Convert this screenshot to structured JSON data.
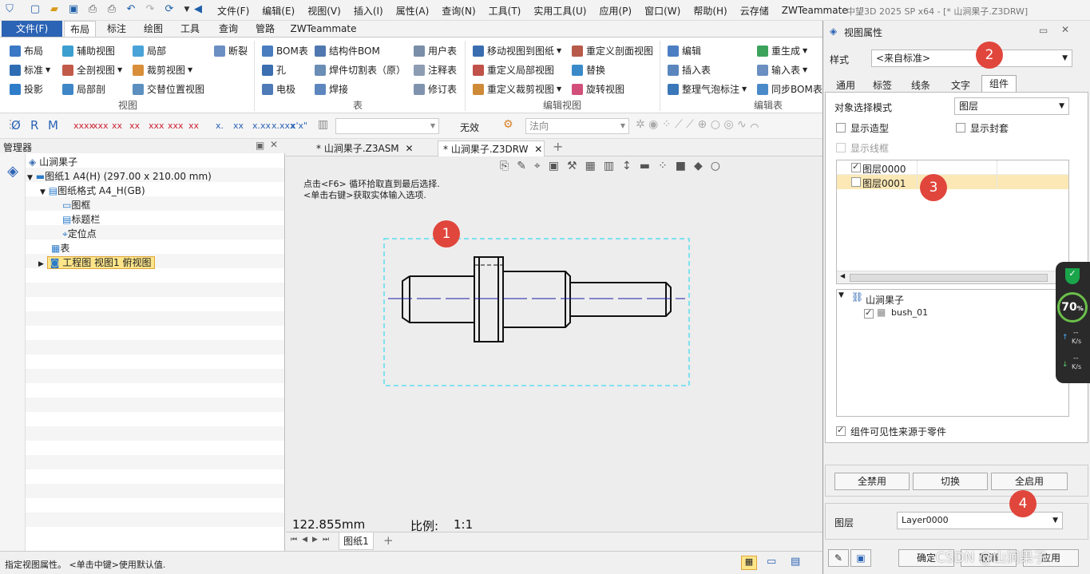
{
  "titlebar": {
    "menus": [
      "文件(F)",
      "编辑(E)",
      "视图(V)",
      "插入(I)",
      "属性(A)",
      "查询(N)",
      "工具(T)",
      "实用工具(U)",
      "应用(P)",
      "窗口(W)",
      "帮助(H)",
      "云存储",
      "ZWTeammate"
    ],
    "window_title": "中望3D 2025 SP x64 - [* 山涧果子.Z3DRW]"
  },
  "ribbon": {
    "file_tab": "文件(F)",
    "tabs": [
      "布局",
      "标注",
      "绘图",
      "工具",
      "查询",
      "管路",
      "ZWTeammate"
    ],
    "active_tab": "布局",
    "view_group": {
      "label": "视图",
      "items": [
        "布局",
        "辅助视图",
        "局部",
        "断裂",
        "标准",
        "全剖视图",
        "裁剪视图",
        "投影",
        "局部剖",
        "交替位置视图"
      ]
    },
    "table_group": {
      "label": "表",
      "items": [
        "BOM表",
        "结构件BOM",
        "用户表",
        "孔",
        "焊件切割表（原）",
        "注释表",
        "电极",
        "焊接",
        "修订表"
      ]
    },
    "edit_view_group": {
      "label": "编辑视图",
      "items": [
        "移动视图到图纸",
        "重定义剖面视图",
        "重定义局部视图",
        "替换",
        "重定义裁剪视图",
        "旋转视图"
      ]
    },
    "edit_table_group": {
      "label": "编辑表",
      "items": [
        "编辑",
        "重生成",
        "插入表",
        "输入表",
        "整理气泡标注",
        "同步BOM表"
      ]
    }
  },
  "strip": {
    "invalid_label": "无效",
    "normal_placeholder": "法向"
  },
  "manager": {
    "title": "管理器",
    "tree": [
      {
        "label": "山涧果子",
        "indent": 0
      },
      {
        "label": "图纸1 A4(H) (297.00 x 210.00 mm)",
        "indent": 1
      },
      {
        "label": "图纸格式 A4_H(GB)",
        "indent": 2
      },
      {
        "label": "图框",
        "indent": 3
      },
      {
        "label": "标题栏",
        "indent": 3
      },
      {
        "label": "定位点",
        "indent": 3
      },
      {
        "label": "表",
        "indent": 2
      },
      {
        "label": "工程图 视图1 俯视图",
        "indent": 2,
        "selected": true
      }
    ]
  },
  "doc_tabs": [
    "* 山涧果子.Z3ASM",
    "* 山涧果子.Z3DRW"
  ],
  "canvas": {
    "hint1": "点击<F6> 循环拾取直到最后选择.",
    "hint2": "<单击右键>获取实体输入选项.",
    "measure": "122.855mm",
    "scale_label": "比例:",
    "scale_value": "1:1",
    "sheet_tab": "图纸1"
  },
  "status": {
    "text": "指定视图属性。 <单击中键>使用默认值."
  },
  "dialog": {
    "title": "视图属性",
    "style_label": "样式",
    "style_value": "<来自标准>",
    "tabs": [
      "通用",
      "标签",
      "线条",
      "文字",
      "组件"
    ],
    "active_tab": "组件",
    "select_mode_label": "对象选择模式",
    "select_mode_value": "图层",
    "show_shape": "显示造型",
    "show_cover": "显示封套",
    "show_wire": "显示线框",
    "layers": [
      {
        "name": "图层0000",
        "checked": true
      },
      {
        "name": "图层0001",
        "checked": false,
        "highlight": true
      }
    ],
    "tree_root": "山涧果子",
    "tree_child": "bush_01",
    "visibility_label": "组件可见性来源于零件",
    "btn_disable_all": "全禁用",
    "btn_toggle": "切换",
    "btn_enable_all": "全启用",
    "layer_label": "图层",
    "layer_value": "Layer0000",
    "btn_ok": "确定",
    "btn_cancel": "取消",
    "btn_apply": "应用"
  },
  "badges": [
    "1",
    "2",
    "3",
    "4"
  ],
  "perf": {
    "percent": "70",
    "unit": "%",
    "up": "--",
    "down": "--",
    "rate": "K/s"
  },
  "watermark": "CSDN @山涧果子"
}
